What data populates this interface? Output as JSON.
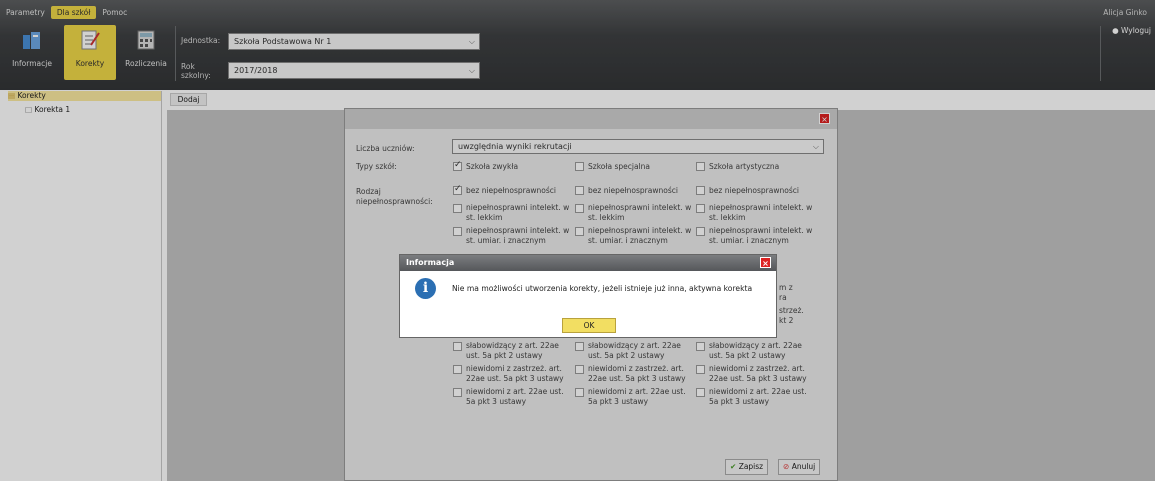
{
  "menu": {
    "tabs": [
      "Parametry",
      "Dla szkół",
      "Pomoc"
    ],
    "user": "Alicja Ginko",
    "logout": "Wyloguj"
  },
  "toolbar": {
    "informacje": "Informacje",
    "korekty": "Korekty",
    "rozliczenia": "Rozliczenia"
  },
  "fields": {
    "jednostka_label": "Jednostka:",
    "jednostka_value": "Szkoła Podstawowa Nr 1",
    "rok_label_1": "Rok",
    "rok_label_2": "szkolny:",
    "rok_value": "2017/2018"
  },
  "tree": {
    "root": "Korekty",
    "child": "Korekta 1"
  },
  "main": {
    "dodaj": "Dodaj"
  },
  "dialog": {
    "liczba_label": "Liczba uczniów:",
    "liczba_value": "uwzględnia wyniki rekrutacji",
    "typy_label": "Typy szkół:",
    "types": [
      {
        "label": "Szkoła zwykła",
        "checked": true
      },
      {
        "label": "Szkoła specjalna",
        "checked": false
      },
      {
        "label": "Szkoła artystyczna",
        "checked": false
      }
    ],
    "rodzaj_label_1": "Rodzaj",
    "rodzaj_label_2": "niepełnosprawności:",
    "col1": [
      "bez niepełnosprawności",
      "niepełnosprawni intelekt. w",
      "st. lekkim",
      "niepełnosprawni intelekt. w",
      "st. umiar. i znacznym",
      "słabowidzący z art. 22ae",
      "ust. 5a pkt 2 ustawy",
      "niewidomi z zastrzeż. art.",
      "22ae ust. 5a pkt 3 ustawy",
      "niewidomi z art. 22ae ust.",
      "5a pkt 3 ustawy"
    ],
    "col2": [
      "bez niepełnosprawności",
      "niepełnosprawni intelekt. w",
      "st. lekkim",
      "niepełnosprawni intelekt. w",
      "st. umiar. i znacznym",
      "słabowidzący z art. 22ae",
      "ust. 5a pkt 2 ustawy",
      "niewidomi z zastrzeż. art.",
      "22ae ust. 5a pkt 3 ustawy",
      "niewidomi z art. 22ae ust.",
      "5a pkt 3 ustawy"
    ],
    "col3": [
      "bez niepełnosprawności",
      "niepełnosprawni intelekt. w",
      "st. lekkim",
      "niepełnosprawni intelekt. w",
      "st. umiar. i znacznym",
      "słabowidzący z art. 22ae",
      "ust. 5a pkt 2 ustawy",
      "niewidomi z zastrzeż. art.",
      "22ae ust. 5a pkt 3 ustawy",
      "niewidomi z art. 22ae ust.",
      "5a pkt 3 ustawy"
    ],
    "peek": [
      "m z",
      "ra",
      "strzeż.",
      "kt 2"
    ],
    "zapisz": "Zapisz",
    "anuluj": "Anuluj"
  },
  "message": {
    "title": "Informacja",
    "text": "Nie ma możliwości utworzenia korekty, jeżeli istnieje już inna, aktywna korekta",
    "ok": "OK"
  }
}
